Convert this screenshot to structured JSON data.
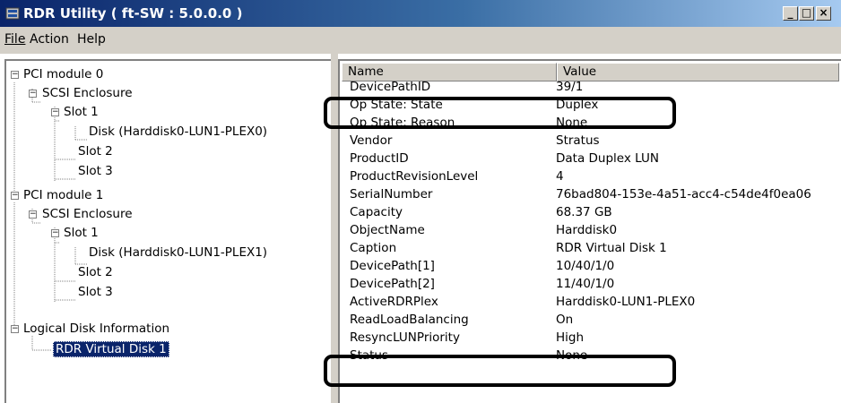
{
  "window": {
    "title": "RDR Utility ( ft-SW : 5.0.0.0 )",
    "minimize_glyph": "_",
    "maximize_glyph": "□",
    "close_glyph": "×"
  },
  "menu": [
    "File",
    "Action",
    "Help"
  ],
  "tree": {
    "pci0": "PCI module 0",
    "pci0_enc": "SCSI Enclosure",
    "pci0_slot1": "Slot 1",
    "pci0_disk": "Disk (Harddisk0-LUN1-PLEX0)",
    "pci0_slot2": "Slot 2",
    "pci0_slot3": "Slot 3",
    "pci1": "PCI module 1",
    "pci1_enc": "SCSI Enclosure",
    "pci1_slot1": "Slot 1",
    "pci1_disk": "Disk (Harddisk0-LUN1-PLEX1)",
    "pci1_slot2": "Slot 2",
    "pci1_slot3": "Slot 3",
    "logical": "Logical Disk Information",
    "vdisk": "RDR Virtual Disk 1"
  },
  "list": {
    "col_name": "Name",
    "col_value": "Value",
    "rows": [
      {
        "name": "DevicePathID",
        "value": "39/1"
      },
      {
        "name": "Op State: State",
        "value": "Duplex"
      },
      {
        "name": "Op State: Reason",
        "value": "None"
      },
      {
        "name": "Vendor",
        "value": "Stratus"
      },
      {
        "name": "ProductID",
        "value": "Data Duplex LUN"
      },
      {
        "name": "ProductRevisionLevel",
        "value": "4"
      },
      {
        "name": "SerialNumber",
        "value": "76bad804-153e-4a51-acc4-c54de4f0ea06"
      },
      {
        "name": "Capacity",
        "value": "68.37 GB"
      },
      {
        "name": "ObjectName",
        "value": "Harddisk0"
      },
      {
        "name": "Caption",
        "value": "RDR Virtual Disk 1"
      },
      {
        "name": "DevicePath[1]",
        "value": "10/40/1/0"
      },
      {
        "name": "DevicePath[2]",
        "value": "11/40/1/0"
      },
      {
        "name": "ActiveRDRPlex",
        "value": "Harddisk0-LUN1-PLEX0"
      },
      {
        "name": "ReadLoadBalancing",
        "value": "On"
      },
      {
        "name": "ResyncLUNPriority",
        "value": "High"
      },
      {
        "name": "Status",
        "value": "None"
      }
    ]
  }
}
